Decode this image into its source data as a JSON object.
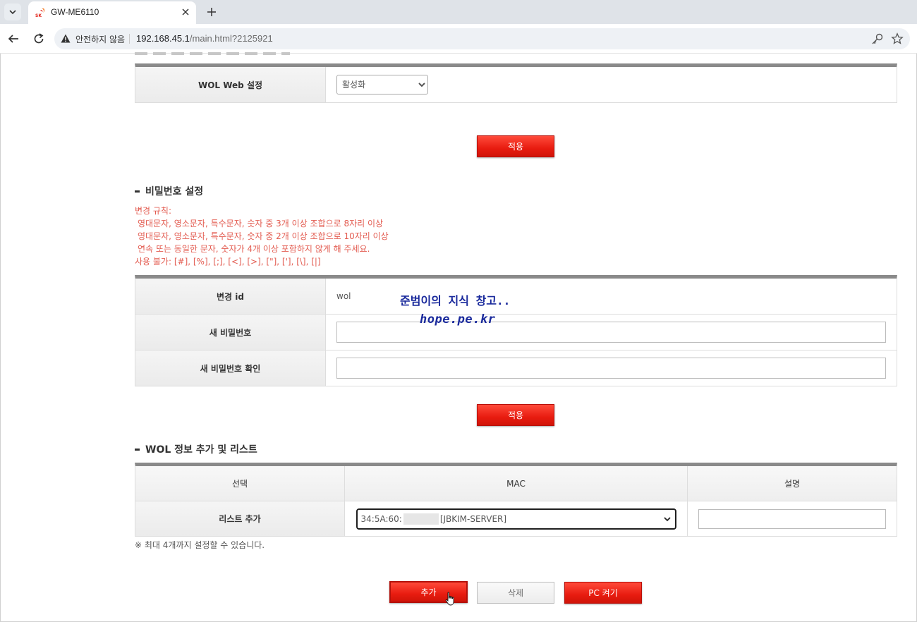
{
  "browser": {
    "tab_title": "GW-ME6110",
    "favicon_text": "SK",
    "security_label": "안전하지 않음",
    "url_host": "192.168.45.1",
    "url_path": "/main.html?2125921"
  },
  "wol_web": {
    "label": "WOL Web 설정",
    "selected": "활성화"
  },
  "apply_label": "적용",
  "password": {
    "title": "비밀번호 설정",
    "rules": [
      "변경 규칙:",
      " 영대문자, 영소문자, 특수문자, 숫자 중 3개 이상 조합으로 8자리 이상",
      " 영대문자, 영소문자, 특수문자, 숫자 중 2개 이상 조합으로 10자리 이상",
      " 연속 또는 동일한 문자, 숫자가 4개 이상 포함하지 않게 해 주세요.",
      "사용 불가: [#], [%], [;], [<], [>], [\"], ['], [\\], [|]"
    ],
    "id_label": "변경 id",
    "id_value": "wol",
    "new_pw_label": "새 비밀번호",
    "confirm_pw_label": "새 비밀번호 확인"
  },
  "watermark": {
    "line1": "준범이의 지식 창고..",
    "line2": "hope.pe.kr"
  },
  "wol_list": {
    "title": "WOL 정보 추가 및 리스트",
    "headers": [
      "선택",
      "MAC",
      "설명"
    ],
    "row_label": "리스트 추가",
    "mac_prefix": "34:5A:60:",
    "mac_suffix": "[JBKIM-SERVER]",
    "note": "※ 최대 4개까지 설정할 수 있습니다."
  },
  "buttons": {
    "add": "추가",
    "delete": "삭제",
    "power_on": "PC 켜기"
  }
}
